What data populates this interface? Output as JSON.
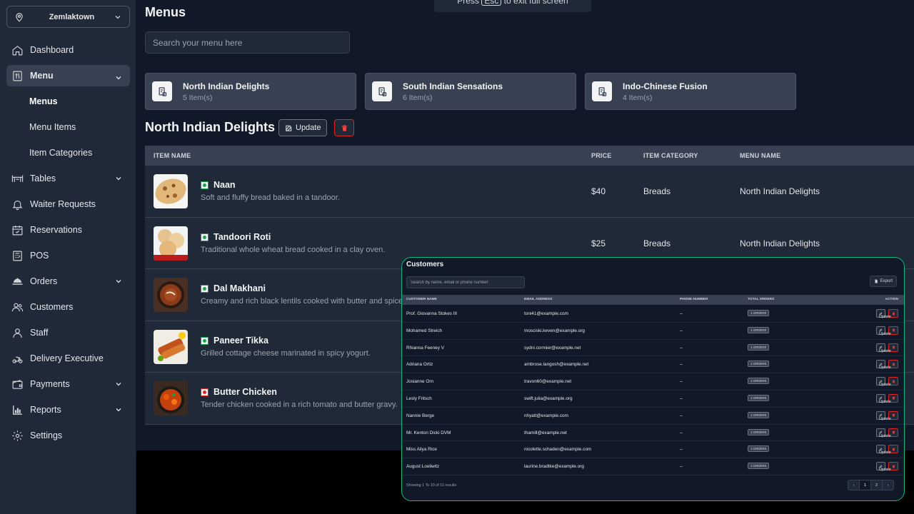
{
  "fullscreen_toast": {
    "before": "Press",
    "key": "Esc",
    "after": "to exit full screen"
  },
  "branch": {
    "name": "Zemlaktown"
  },
  "sidebar": {
    "items": [
      {
        "label": "Dashboard",
        "icon": "home-icon"
      },
      {
        "label": "Menu",
        "icon": "menu-book-icon",
        "active": true
      },
      {
        "label": "Menus",
        "sub": true,
        "current": true
      },
      {
        "label": "Menu Items",
        "sub": true
      },
      {
        "label": "Item Categories",
        "sub": true
      },
      {
        "label": "Tables",
        "icon": "table-icon"
      },
      {
        "label": "Waiter Requests",
        "icon": "bell-icon"
      },
      {
        "label": "Reservations",
        "icon": "calendar-check-icon"
      },
      {
        "label": "POS",
        "icon": "pos-icon"
      },
      {
        "label": "Orders",
        "icon": "cloche-icon"
      },
      {
        "label": "Customers",
        "icon": "users-icon"
      },
      {
        "label": "Staff",
        "icon": "user-icon"
      },
      {
        "label": "Delivery Executive",
        "icon": "scooter-icon"
      },
      {
        "label": "Payments",
        "icon": "wallet-icon"
      },
      {
        "label": "Reports",
        "icon": "chart-icon"
      },
      {
        "label": "Settings",
        "icon": "gear-icon"
      }
    ]
  },
  "page": {
    "title": "Menus"
  },
  "search": {
    "placeholder": "Search your menu here"
  },
  "menus": [
    {
      "name": "North Indian Delights",
      "count": "5 Item(s)"
    },
    {
      "name": "South Indian Sensations",
      "count": "6 Item(s)"
    },
    {
      "name": "Indo-Chinese Fusion",
      "count": "4 Item(s)"
    }
  ],
  "section": {
    "title": "North Indian Delights",
    "update_label": "Update"
  },
  "items_table": {
    "headers": {
      "name": "Item Name",
      "price": "Price",
      "category": "Item Category",
      "menu": "Menu Name"
    },
    "rows": [
      {
        "name": "Naan",
        "desc": "Soft and fluffy bread baked in a tandoor.",
        "price": "$40",
        "category": "Breads",
        "menu": "North Indian Delights",
        "type": "veg"
      },
      {
        "name": "Tandoori Roti",
        "desc": "Traditional whole wheat bread cooked in a clay oven.",
        "price": "$25",
        "category": "Breads",
        "menu": "North Indian Delights",
        "type": "veg"
      },
      {
        "name": "Dal Makhani",
        "desc": "Creamy and rich black lentils cooked with butter and spices.",
        "price": "",
        "category": "",
        "menu": "",
        "type": "veg"
      },
      {
        "name": "Paneer Tikka",
        "desc": "Grilled cottage cheese marinated in spicy yogurt.",
        "price": "",
        "category": "",
        "menu": "",
        "type": "veg"
      },
      {
        "name": "Butter Chicken",
        "desc": "Tender chicken cooked in a rich tomato and butter gravy.",
        "price": "",
        "category": "",
        "menu": "",
        "type": "nonveg"
      }
    ]
  },
  "customers": {
    "title": "Customers",
    "search_placeholder": "Search by name, email or phone number",
    "export_label": "Export",
    "headers": {
      "name": "Customer Name",
      "email": "Email Address",
      "phone": "Phone Number",
      "orders": "Total Orders",
      "action": "Action"
    },
    "rows": [
      {
        "name": "Prof. Giovanna Stokes III",
        "email": "toni41@example.com",
        "phone": "--",
        "orders": "1 Orders"
      },
      {
        "name": "Mohamed Streich",
        "email": "mosciski.keven@example.org",
        "phone": "--",
        "orders": "1 Orders"
      },
      {
        "name": "Rhianna Feeney V",
        "email": "sydni.cormier@example.net",
        "phone": "--",
        "orders": "1 Orders"
      },
      {
        "name": "Adriana Ortiz",
        "email": "ambrose.langosh@example.net",
        "phone": "--",
        "orders": "1 Orders"
      },
      {
        "name": "Josianne Orn",
        "email": "travon60@example.net",
        "phone": "--",
        "orders": "1 Orders"
      },
      {
        "name": "Lesly Fritsch",
        "email": "swift.julia@example.org",
        "phone": "--",
        "orders": "1 Orders"
      },
      {
        "name": "Nannie Berge",
        "email": "nhyatt@example.com",
        "phone": "--",
        "orders": "1 Orders"
      },
      {
        "name": "Mr. Kenton Dicki DVM",
        "email": "thamill@example.net",
        "phone": "--",
        "orders": "1 Orders"
      },
      {
        "name": "Miss Aliya Rice",
        "email": "nicolette.schaden@example.com",
        "phone": "--",
        "orders": "1 Orders"
      },
      {
        "name": "August Loeliwitz",
        "email": "laurine.bradtke@example.org",
        "phone": "--",
        "orders": "1 Orders"
      }
    ],
    "update_label": "Update",
    "footer": "Showing 1 To 10 of 11 results",
    "pages": [
      "‹",
      "1",
      "2",
      "›"
    ]
  }
}
